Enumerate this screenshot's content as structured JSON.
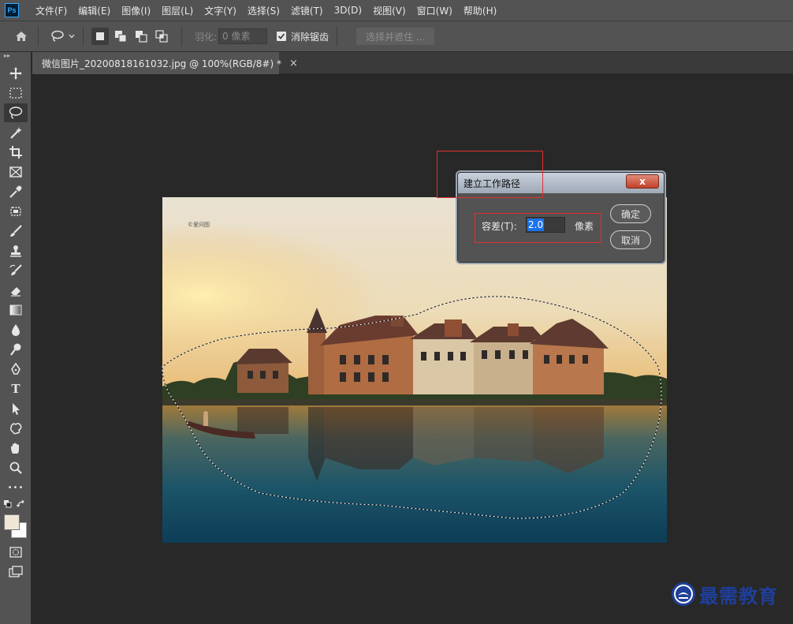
{
  "app": {
    "logo_text": "Ps"
  },
  "menu": [
    "文件(F)",
    "编辑(E)",
    "图像(I)",
    "图层(L)",
    "文字(Y)",
    "选择(S)",
    "滤镜(T)",
    "3D(D)",
    "视图(V)",
    "窗口(W)",
    "帮助(H)"
  ],
  "options_bar": {
    "feather_label": "羽化:",
    "feather_value": "0 像素",
    "antialias_label": "消除锯齿",
    "antialias_checked": true,
    "select_mask_label": "选择并遮住 ..."
  },
  "document_tab": {
    "title": "微信图片_20200818161032.jpg @ 100%(RGB/8#) *",
    "close": "×"
  },
  "tools": [
    "move-icon",
    "marquee-icon",
    "lasso-icon",
    "magic-wand-icon",
    "crop-icon",
    "frame-icon",
    "eyedropper-icon",
    "healing-icon",
    "brush-icon",
    "stamp-icon",
    "history-brush-icon",
    "eraser-icon",
    "gradient-icon",
    "blur-icon",
    "dodge-icon",
    "pen-icon",
    "type-icon",
    "path-select-icon",
    "shape-icon",
    "hand-icon",
    "zoom-icon",
    "more-icon"
  ],
  "type_tool_glyph": "T",
  "more_tool_glyph": "•••",
  "colors": {
    "foreground": "#efe6d6",
    "background": "#ffffff",
    "selection": "#ffffff",
    "annotation": "#e03030"
  },
  "dialog": {
    "title": "建立工作路径",
    "close_label": "x",
    "tolerance_label": "容差(T):",
    "tolerance_value": "2.0",
    "unit": "像素",
    "ok_label": "确定",
    "cancel_label": "取消"
  },
  "photo": {
    "watermark": "©爱问图"
  },
  "brand": {
    "text": "最需教育"
  }
}
